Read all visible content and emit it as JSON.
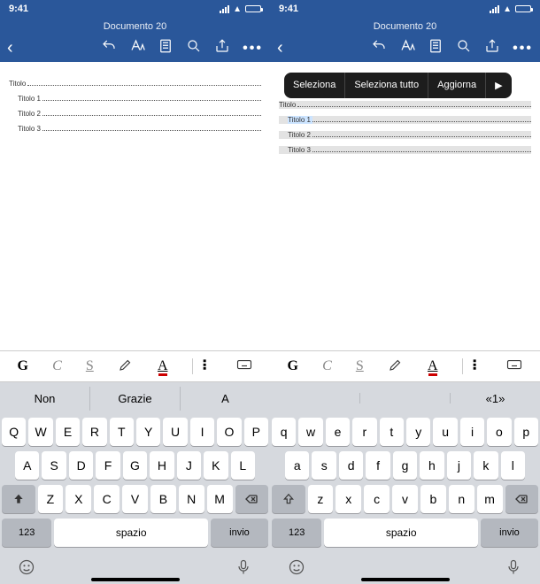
{
  "status": {
    "time": "9:41"
  },
  "header": {
    "doc_title": "Documento 20"
  },
  "toc": {
    "root": "Titolo",
    "items": [
      "Titolo 1",
      "Titolo 2",
      "Titolo 3"
    ]
  },
  "context_menu": {
    "select": "Seleziona",
    "select_all": "Seleziona tutto",
    "update": "Aggiorna",
    "arrow": "▶"
  },
  "format_bar": {
    "bold": "G",
    "italic": "C",
    "underline": "S",
    "font_color_letter": "A"
  },
  "suggestions": {
    "left": [
      "Non",
      "Grazie",
      "A"
    ],
    "right": [
      "",
      "",
      "«1»"
    ]
  },
  "keyboard": {
    "left_rows": [
      [
        "Q",
        "W",
        "E",
        "R",
        "T",
        "Y",
        "U",
        "I",
        "O",
        "P"
      ],
      [
        "A",
        "S",
        "D",
        "F",
        "G",
        "H",
        "J",
        "K",
        "L"
      ],
      [
        "Z",
        "X",
        "C",
        "V",
        "B",
        "N",
        "M"
      ]
    ],
    "right_rows": [
      [
        "q",
        "w",
        "e",
        "r",
        "t",
        "y",
        "u",
        "i",
        "o",
        "p"
      ],
      [
        "a",
        "s",
        "d",
        "f",
        "g",
        "h",
        "j",
        "k",
        "l"
      ],
      [
        "z",
        "x",
        "c",
        "v",
        "b",
        "n",
        "m"
      ]
    ],
    "num": "123",
    "space": "spazio",
    "enter": "invio"
  }
}
